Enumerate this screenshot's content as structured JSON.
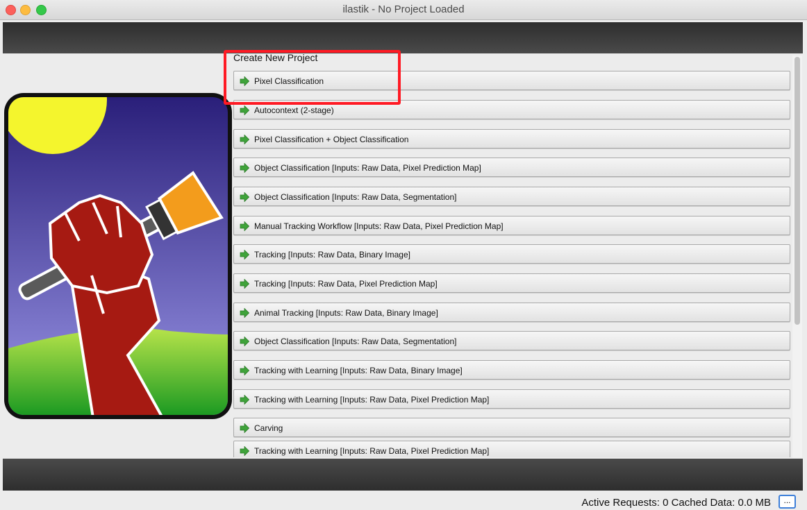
{
  "window": {
    "title": "ilastik - No Project Loaded"
  },
  "create_new_project": {
    "heading": "Create New Project",
    "workflows": [
      {
        "label": "Pixel Classification"
      },
      {
        "label": "Autocontext (2-stage)"
      },
      {
        "label": "Pixel Classification + Object Classification"
      },
      {
        "label": "Object Classification [Inputs: Raw Data, Pixel Prediction Map]"
      },
      {
        "label": "Object Classification [Inputs: Raw Data, Segmentation]"
      },
      {
        "label": "Manual Tracking Workflow [Inputs: Raw Data, Pixel Prediction Map]"
      },
      {
        "label": "Tracking [Inputs: Raw Data, Binary Image]"
      },
      {
        "label": "Tracking [Inputs: Raw Data, Pixel Prediction Map]"
      },
      {
        "label": "Animal Tracking [Inputs: Raw Data, Binary Image]"
      },
      {
        "label": "Object Classification [Inputs: Raw Data, Segmentation]"
      },
      {
        "label": "Tracking with Learning [Inputs: Raw Data, Binary Image]"
      },
      {
        "label": "Tracking with Learning [Inputs: Raw Data, Pixel Prediction Map]"
      },
      {
        "label": "Carving"
      },
      {
        "label": "Tracking with Learning [Inputs: Raw Data, Pixel Prediction Map]"
      }
    ],
    "item_icon": "green-arrow-icon"
  },
  "status_bar": {
    "text": "Active Requests: 0  Cached Data: 0.0 MB",
    "button_label": "..."
  },
  "colors": {
    "highlight": "#ff1a24",
    "arrow": "#3fa33a",
    "toolbar": "#3a3a3a"
  }
}
